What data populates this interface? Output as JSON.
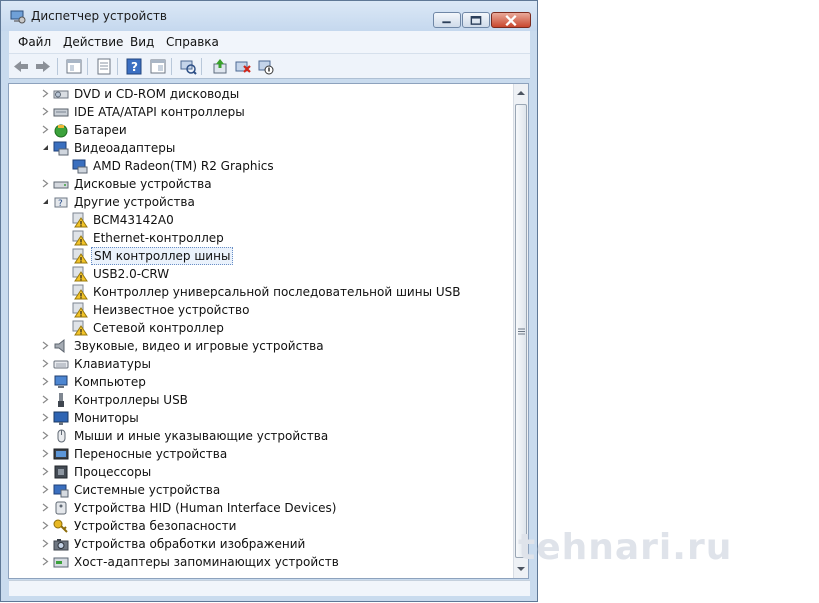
{
  "window": {
    "title": "Диспетчер устройств"
  },
  "menu": [
    "Файл",
    "Действие",
    "Вид",
    "Справка"
  ],
  "tree": [
    {
      "label": "DVD и CD-ROM дисководы",
      "level": 0,
      "expanded": false,
      "icon": "dvd-drive-icon"
    },
    {
      "label": "IDE ATA/ATAPI контроллеры",
      "level": 0,
      "expanded": false,
      "icon": "ide-controller-icon"
    },
    {
      "label": "Батареи",
      "level": 0,
      "expanded": false,
      "icon": "battery-icon"
    },
    {
      "label": "Видеоадаптеры",
      "level": 0,
      "expanded": true,
      "icon": "display-adapter-icon"
    },
    {
      "label": "AMD Radeon(TM) R2 Graphics",
      "level": 1,
      "icon": "display-adapter-icon"
    },
    {
      "label": "Дисковые устройства",
      "level": 0,
      "expanded": false,
      "icon": "disk-drive-icon"
    },
    {
      "label": "Другие устройства",
      "level": 0,
      "expanded": true,
      "icon": "unknown-device-icon"
    },
    {
      "label": "BCM43142A0",
      "level": 1,
      "icon": "warning-device-icon"
    },
    {
      "label": "Ethernet-контроллер",
      "level": 1,
      "icon": "warning-device-icon"
    },
    {
      "label": "SM контроллер шины",
      "level": 1,
      "icon": "warning-device-icon",
      "selected": true
    },
    {
      "label": "USB2.0-CRW",
      "level": 1,
      "icon": "warning-device-icon"
    },
    {
      "label": "Контроллер универсальной последовательной шины USB",
      "level": 1,
      "icon": "warning-device-icon"
    },
    {
      "label": "Неизвестное устройство",
      "level": 1,
      "icon": "warning-device-icon"
    },
    {
      "label": "Сетевой контроллер",
      "level": 1,
      "icon": "warning-device-icon"
    },
    {
      "label": "Звуковые, видео и игровые устройства",
      "level": 0,
      "expanded": false,
      "icon": "speaker-icon"
    },
    {
      "label": "Клавиатуры",
      "level": 0,
      "expanded": false,
      "icon": "keyboard-icon"
    },
    {
      "label": "Компьютер",
      "level": 0,
      "expanded": false,
      "icon": "computer-icon"
    },
    {
      "label": "Контроллеры USB",
      "level": 0,
      "expanded": false,
      "icon": "usb-icon"
    },
    {
      "label": "Мониторы",
      "level": 0,
      "expanded": false,
      "icon": "monitor-icon"
    },
    {
      "label": "Мыши и иные указывающие устройства",
      "level": 0,
      "expanded": false,
      "icon": "mouse-icon"
    },
    {
      "label": "Переносные устройства",
      "level": 0,
      "expanded": false,
      "icon": "portable-device-icon"
    },
    {
      "label": "Процессоры",
      "level": 0,
      "expanded": false,
      "icon": "processor-icon"
    },
    {
      "label": "Системные устройства",
      "level": 0,
      "expanded": false,
      "icon": "system-device-icon"
    },
    {
      "label": "Устройства HID (Human Interface Devices)",
      "level": 0,
      "expanded": false,
      "icon": "hid-icon"
    },
    {
      "label": "Устройства безопасности",
      "level": 0,
      "expanded": false,
      "icon": "security-key-icon"
    },
    {
      "label": "Устройства обработки изображений",
      "level": 0,
      "expanded": false,
      "icon": "camera-icon"
    },
    {
      "label": "Хост-адаптеры запоминающих устройств",
      "level": 0,
      "expanded": false,
      "icon": "storage-adapter-icon"
    }
  ],
  "toolbar": [
    "back-icon",
    "forward-icon",
    "up-level-icon",
    "properties-icon",
    "help-icon",
    "show-hide-icon",
    "scan-hardware-icon",
    "update-driver-icon",
    "uninstall-icon",
    "disable-device-icon"
  ],
  "watermark": "tehnari.ru"
}
